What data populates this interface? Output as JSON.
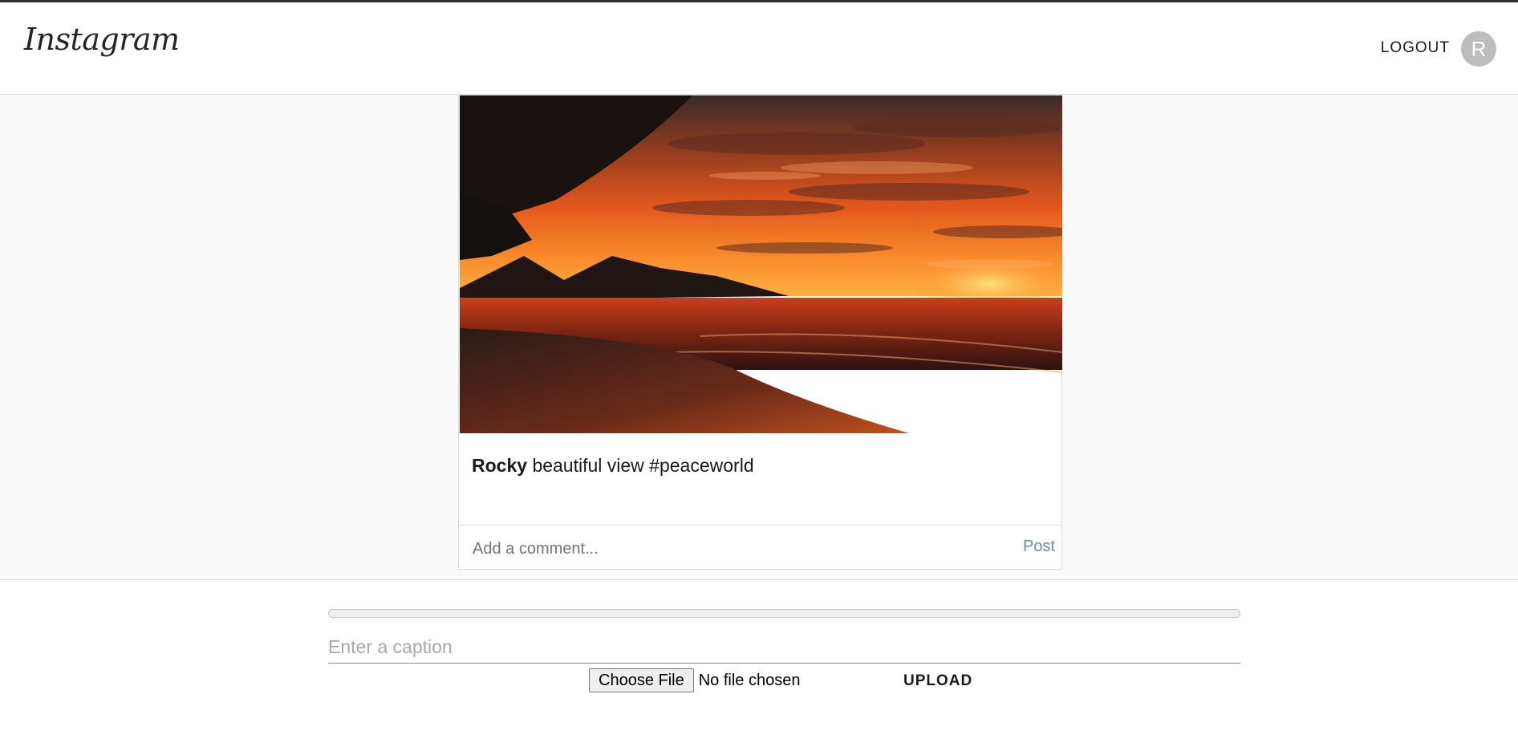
{
  "header": {
    "logo_text": "Instagram",
    "logout_label": "LOGOUT",
    "avatar_letter": "R"
  },
  "post": {
    "image_icon": "sunset-beach-photo",
    "username": "Rocky",
    "caption": "beautiful view #peaceworld",
    "comment_placeholder": "Add a comment...",
    "post_label": "Post"
  },
  "upload": {
    "progress_value": 0,
    "caption_placeholder": "Enter a caption",
    "choose_file_label": "Choose File",
    "file_status": "No file chosen",
    "upload_label": "UPLOAD"
  },
  "colors": {
    "post_link": "#6a8aa6",
    "avatar_bg": "#bdbdbd"
  }
}
